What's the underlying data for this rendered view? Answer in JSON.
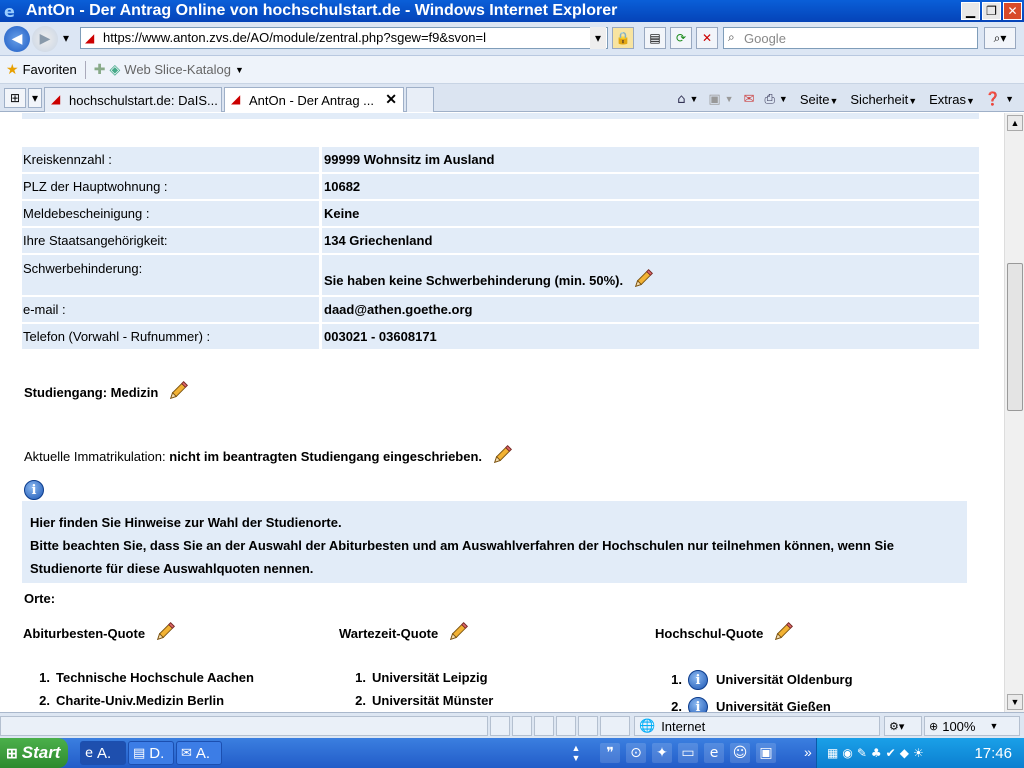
{
  "window": {
    "title": "AntOn - Der Antrag Online von hochschulstart.de - Windows Internet Explorer"
  },
  "addressbar": {
    "url": "https://www.anton.zvs.de/AO/module/zentral.php?sgew=f9&svon=l",
    "search_placeholder": "Google"
  },
  "favorites": {
    "label": "Favoriten",
    "slice_label": "Web Slice-Katalog"
  },
  "tabs": [
    {
      "label": "hochschulstart.de: DaIS..."
    },
    {
      "label": "AntOn - Der Antrag ..."
    }
  ],
  "commandbar": {
    "page": "Seite",
    "safety": "Sicherheit",
    "extras": "Extras"
  },
  "info_table": [
    {
      "label": "Kreiskennzahl :",
      "value": "99999 Wohnsitz im Ausland"
    },
    {
      "label": "PLZ der Hauptwohnung :",
      "value": "10682"
    },
    {
      "label": "Meldebescheinigung :",
      "value": "Keine"
    },
    {
      "label": "Ihre Staatsangehörigkeit:",
      "value": "134 Griechenland"
    },
    {
      "label": "Schwerbehinderung:",
      "value": "Sie haben keine Schwerbehinderung (min. 50%)."
    },
    {
      "label": "e-mail :",
      "value": "daad@athen.goethe.org"
    },
    {
      "label": "Telefon (Vorwahl - Rufnummer) :",
      "value": "003021 - 03608171"
    }
  ],
  "studiengang": "Studiengang: Medizin",
  "immatrikulation": {
    "label": "Aktuelle Immatrikulation:",
    "value": "nicht im beantragten Studiengang eingeschrieben."
  },
  "info_icon_glyph": "i",
  "hinweis": {
    "line1": "Hier finden Sie Hinweise zur Wahl der Studienorte.",
    "line2": "Bitte beachten Sie, dass Sie an der Auswahl der Abiturbesten und am Auswahlverfahren der Hochschulen nur teilnehmen können, wenn Sie",
    "line3": "Studienorte für diese Auswahlquoten nennen."
  },
  "orte_label": "Orte:",
  "quotas": {
    "abitur": {
      "title": "Abiturbesten-Quote",
      "items": [
        {
          "num": "1.",
          "name": "Technische Hochschule Aachen"
        },
        {
          "num": "2.",
          "name": "Charite-Univ.Medizin Berlin"
        }
      ]
    },
    "wartezeit": {
      "title": "Wartezeit-Quote",
      "items": [
        {
          "num": "1.",
          "name": "Universität Leipzig"
        },
        {
          "num": "2.",
          "name": "Universität Münster"
        }
      ]
    },
    "hochschul": {
      "title": "Hochschul-Quote",
      "items": [
        {
          "num": "1.",
          "name": "Universität Oldenburg"
        },
        {
          "num": "2.",
          "name": "Universität Gießen"
        }
      ]
    }
  },
  "statusbar": {
    "zone": "Internet",
    "zoom": "100%"
  },
  "taskbar": {
    "start": "Start",
    "items": [
      {
        "label": "A."
      },
      {
        "label": "D."
      },
      {
        "label": "A."
      }
    ],
    "clock": "17:46"
  }
}
